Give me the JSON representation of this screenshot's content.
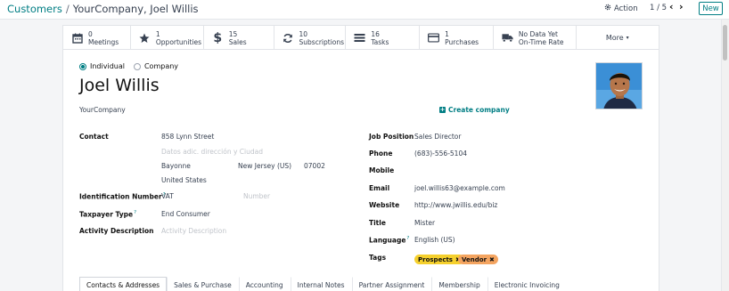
{
  "breadcrumb": {
    "parent": "Customers",
    "separator": "/",
    "current": "YourCompany, Joel Willis"
  },
  "controls": {
    "action_label": "Action",
    "pager": "1 / 5",
    "new_label": "New"
  },
  "smart_buttons": [
    {
      "icon": "calendar-icon",
      "value": "0",
      "label": "Meetings"
    },
    {
      "icon": "star-icon",
      "value": "1",
      "label": "Opportunities"
    },
    {
      "icon": "dollar-icon",
      "value": "15",
      "label": "Sales"
    },
    {
      "icon": "refresh-icon",
      "value": "10",
      "label": "Subscriptions"
    },
    {
      "icon": "list-icon",
      "value": "16",
      "label": "Tasks"
    },
    {
      "icon": "credit-card-icon",
      "value": "1",
      "label": "Purchases"
    },
    {
      "icon": "truck-icon",
      "value": "No Data Yet",
      "label": "On-Time Rate"
    }
  ],
  "more_label": "More",
  "company_type": {
    "individual": "Individual",
    "company": "Company",
    "selected": "individual"
  },
  "partner": {
    "name": "Joel Willis",
    "company": "YourCompany",
    "create_company": "Create company"
  },
  "left_fields": {
    "contact_label": "Contact",
    "street": "858 Lynn Street",
    "street2_placeholder": "Datos adic. dirección y Ciudad",
    "city": "Bayonne",
    "state": "New Jersey (US)",
    "zip": "07002",
    "country": "United States",
    "identification_label": "Identification Number",
    "id_type": "VAT",
    "id_number_placeholder": "Number",
    "taxpayer_label": "Taxpayer Type",
    "taxpayer_value": "End Consumer",
    "activity_label": "Activity Description",
    "activity_placeholder": "Activity Description",
    "help_mark": "?"
  },
  "right_fields": {
    "job_label": "Job Position",
    "job_value": "Sales Director",
    "phone_label": "Phone",
    "phone_value": "(683)-556-5104",
    "mobile_label": "Mobile",
    "email_label": "Email",
    "email_value": "joel.willis63@example.com",
    "website_label": "Website",
    "website_value": "http://www.jwillis.edu/biz",
    "title_label": "Title",
    "title_value": "Mister",
    "language_label": "Language",
    "language_value": "English (US)",
    "tags_label": "Tags",
    "tags": [
      {
        "label": "Prospects",
        "color": "#f5d02d"
      },
      {
        "label": "Vendor",
        "color": "#f4a460"
      }
    ]
  },
  "tabs": [
    "Contacts & Addresses",
    "Sales & Purchase",
    "Accounting",
    "Internal Notes",
    "Partner Assignment",
    "Membership",
    "Electronic Invoicing"
  ],
  "colors": {
    "accent": "#017e84",
    "text": "#374151",
    "background": "#f4f5f7"
  }
}
